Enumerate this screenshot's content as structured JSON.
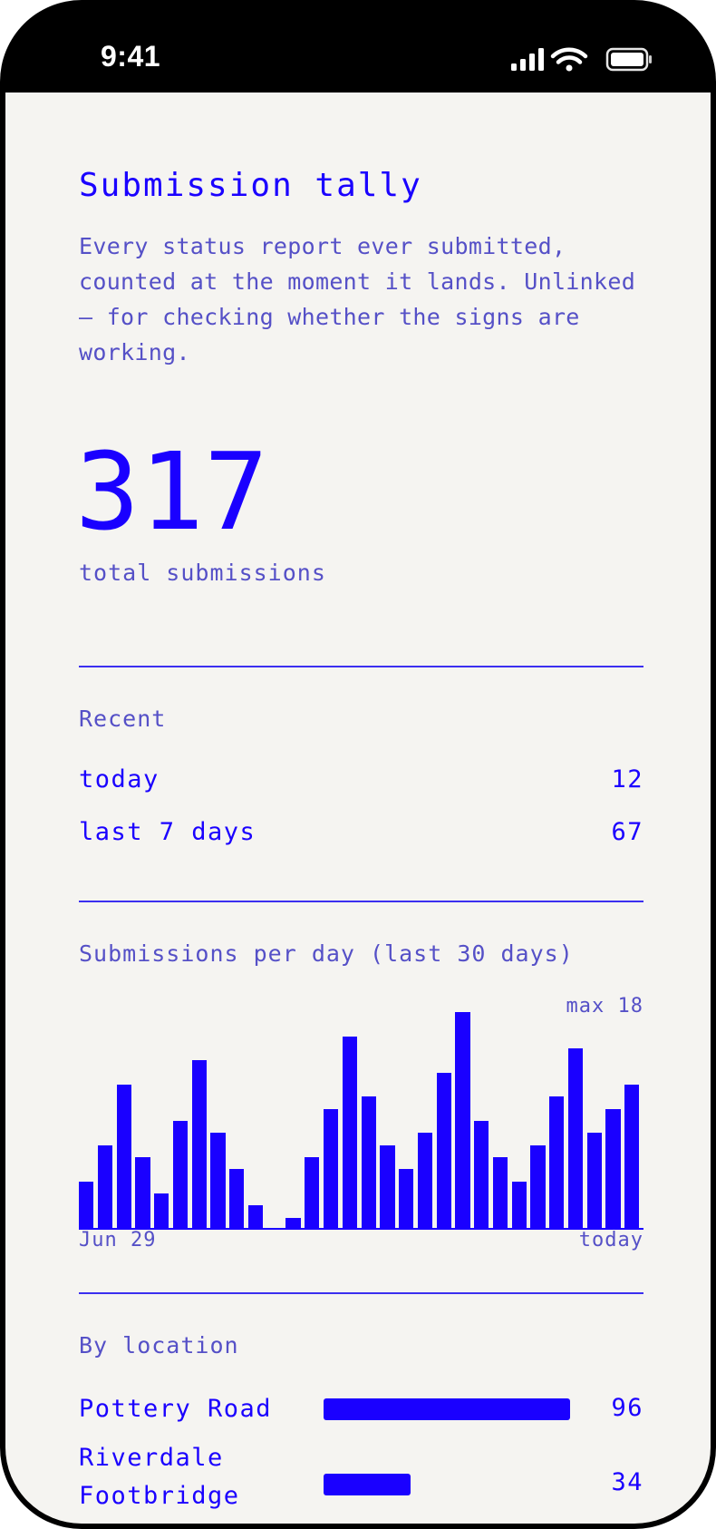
{
  "status_bar": {
    "time": "9:41",
    "icons": [
      "signal-icon",
      "wifi-icon",
      "battery-icon"
    ]
  },
  "header": {
    "title": "Submission tally",
    "description": "Every status report ever submitted, counted at the moment it lands. Unlinked — for checking whether the signs are working."
  },
  "total": {
    "value": "317",
    "label": "total submissions"
  },
  "recent": {
    "label": "Recent",
    "rows": [
      {
        "label": "today",
        "value": "12"
      },
      {
        "label": "last 7 days",
        "value": "67"
      }
    ]
  },
  "daily": {
    "label": "Submissions per day (last 30 days)",
    "max_label": "max 18",
    "start_label": "Jun 29",
    "end_label": "today"
  },
  "chart_data": {
    "type": "bar",
    "title": "Submissions per day (last 30 days)",
    "x_start": "Jun 29",
    "x_end": "today",
    "ymax": 18,
    "values": [
      4,
      7,
      12,
      6,
      3,
      9,
      14,
      8,
      5,
      2,
      0,
      1,
      6,
      10,
      16,
      11,
      7,
      5,
      8,
      13,
      18,
      9,
      6,
      4,
      7,
      11,
      15,
      8,
      10,
      12
    ],
    "color": "#1a00ff"
  },
  "by_location": {
    "label": "By location",
    "max_value": 96,
    "items": [
      {
        "name": "Pottery Road",
        "value": "96",
        "count": 96
      },
      {
        "name": "Riverdale Footbridge",
        "value": "34",
        "count": 34
      }
    ]
  },
  "colors": {
    "accent": "#1a00ff",
    "muted": "#5550c7",
    "background": "#f5f4f1"
  }
}
